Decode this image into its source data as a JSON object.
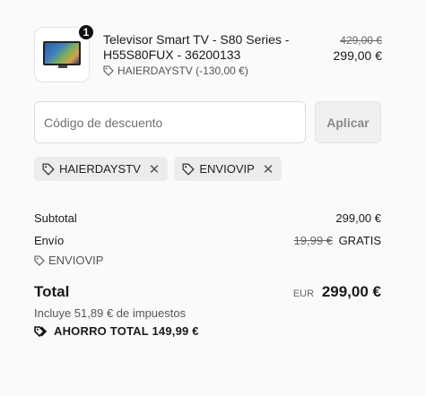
{
  "product": {
    "quantity": "1",
    "title": "Televisor Smart TV - S80 Series - H55S80FUX - 36200133",
    "discount_label": "HAIERDAYSTV (-130,00 €)",
    "original_price": "429,00 €",
    "price": "299,00 €",
    "icon": "tv-thumbnail"
  },
  "discount": {
    "placeholder": "Código de descuento",
    "apply_label": "Aplicar",
    "codes": [
      "HAIERDAYSTV",
      "ENVIOVIP"
    ]
  },
  "totals": {
    "subtotal_label": "Subtotal",
    "subtotal_value": "299,00 €",
    "shipping_label": "Envío",
    "shipping_old": "19,99 €",
    "shipping_value": "GRATIS",
    "shipping_code": "ENVIOVIP",
    "total_label": "Total",
    "currency": "EUR",
    "total_value": "299,00 €",
    "tax_note": "Incluye 51,89 € de impuestos",
    "savings": "AHORRO TOTAL  149,99 €"
  },
  "colors": {
    "background": "#fafafa",
    "chip": "#ececec",
    "button_disabled": "#f0f0f0"
  }
}
